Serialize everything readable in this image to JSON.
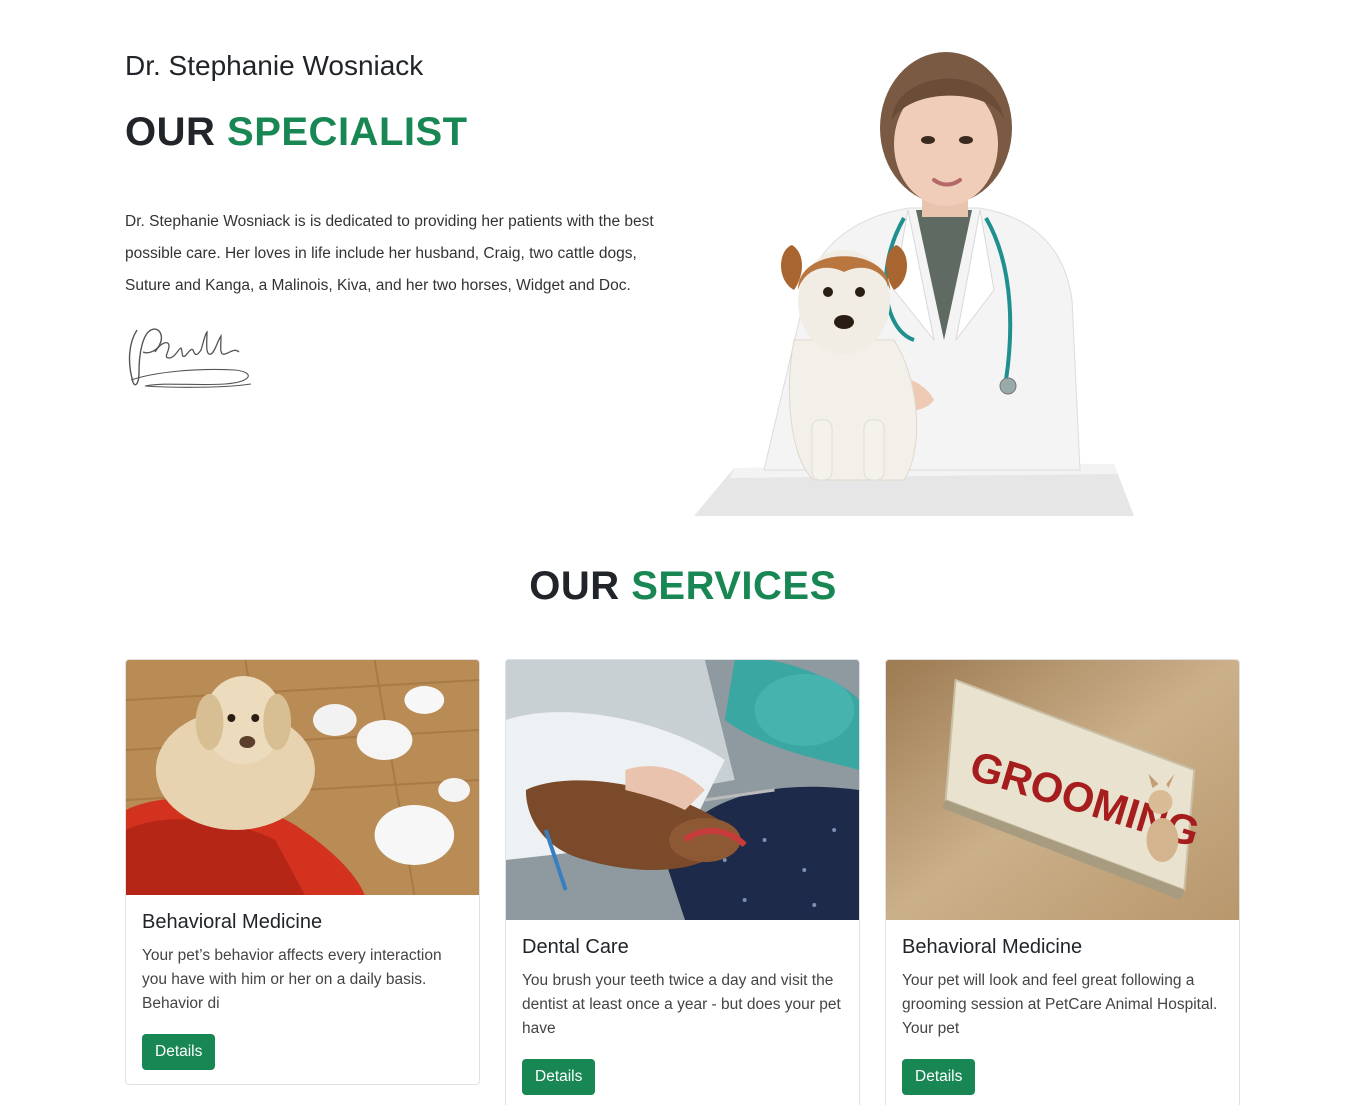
{
  "specialist": {
    "name": "Dr. Stephanie Wosniack",
    "title_prefix": "OUR",
    "title_accent": "SPECIALIST",
    "bio": "Dr. Stephanie Wosniack is is dedicated to providing her patients with the best possible care. Her loves in life include her husband, Craig, two cattle dogs, Suture and Kanga, a Malinois, Kiva, and her two horses, Widget and Doc."
  },
  "services": {
    "title_prefix": "OUR",
    "title_accent": "SERVICES",
    "cards": [
      {
        "title": "Behavioral Medicine",
        "text": "Your pet’s behavior affects every interaction you have with him or her on a daily basis. Behavior di",
        "button": "Details"
      },
      {
        "title": "Dental Care",
        "text": "You brush your teeth twice a day and visit the dentist at least once a year - but does your pet have",
        "button": "Details"
      },
      {
        "title": "Behavioral Medicine",
        "text": "Your pet will look and feel great following a grooming session at PetCare Animal Hospital. Your pet",
        "button": "Details",
        "sign_text": "GROOMING"
      }
    ]
  },
  "colors": {
    "accent": "#198754",
    "text": "#212529"
  }
}
